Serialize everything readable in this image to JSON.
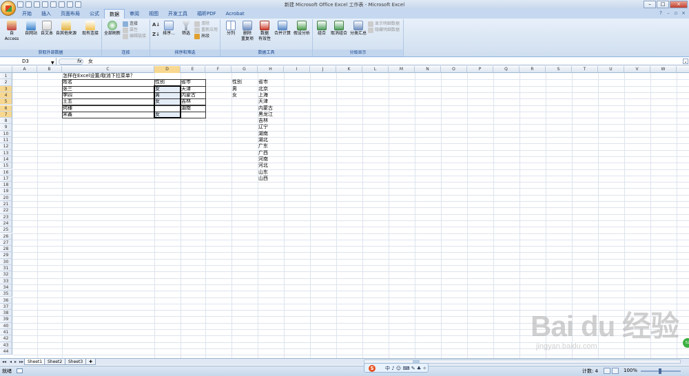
{
  "window": {
    "title": "新建 Microsoft Office Excel 工作表 - Microsoft Excel"
  },
  "ribbon_tabs": [
    {
      "label": "开始",
      "active": false
    },
    {
      "label": "插入",
      "active": false
    },
    {
      "label": "页面布局",
      "active": false
    },
    {
      "label": "公式",
      "active": false
    },
    {
      "label": "数据",
      "active": true
    },
    {
      "label": "审阅",
      "active": false
    },
    {
      "label": "视图",
      "active": false
    },
    {
      "label": "开发工具",
      "active": false
    },
    {
      "label": "福昕PDF",
      "active": false
    },
    {
      "label": "Acrobat",
      "active": false
    }
  ],
  "groups": {
    "external": {
      "title": "获取外部数据",
      "access": "自 Access",
      "web": "自网站",
      "text": "自文本",
      "other": "自其他来源",
      "existing": "现有连接"
    },
    "connections": {
      "title": "连接",
      "refresh_all": "全部刷新",
      "connections": "连接",
      "properties": "属性",
      "edit_links": "编辑链接"
    },
    "sort_filter": {
      "title": "排序和筛选",
      "sort": "排序...",
      "filter": "筛选",
      "clear": "清除",
      "reapply": "重新应用",
      "advanced": "高级"
    },
    "data_tools": {
      "title": "数据工具",
      "text_to_columns": "分列",
      "remove_dup_1": "删除",
      "remove_dup_2": "重复项",
      "validation_1": "数据",
      "validation_2": "有效性",
      "consolidate": "合并计算",
      "whatif": "假设分析"
    },
    "outline": {
      "title": "分级显示",
      "group": "组合",
      "ungroup": "取消组合",
      "subtotal": "分类汇总",
      "show_detail": "显示明细数据",
      "hide_detail": "隐藏明细数据"
    }
  },
  "formula_bar": {
    "name_box": "D3",
    "fx": "fx",
    "value": "女"
  },
  "columns": [
    "A",
    "B",
    "C",
    "D",
    "E",
    "F",
    "G",
    "H",
    "I",
    "J",
    "K",
    "L",
    "M",
    "N",
    "O",
    "P",
    "Q",
    "R",
    "S",
    "T",
    "U",
    "V",
    "W"
  ],
  "row_numbers": [
    "1",
    "2",
    "3",
    "4",
    "5",
    "6",
    "7",
    "8",
    "9",
    "10",
    "11",
    "12",
    "13",
    "14",
    "15",
    "16",
    "17",
    "18",
    "19",
    "20",
    "21",
    "22",
    "23",
    "24",
    "25",
    "26",
    "27",
    "28",
    "29",
    "30",
    "31",
    "32",
    "33",
    "34",
    "35",
    "36",
    "37",
    "38",
    "39",
    "40",
    "41",
    "42",
    "43",
    "44"
  ],
  "cells": {
    "c1": "怎样在Excel设置/取消下拉菜单？",
    "table_headers": [
      "姓名",
      "性别",
      "省市"
    ],
    "names": [
      "张三",
      "李四",
      "王五",
      "何様",
      "宋鑫"
    ],
    "genders": [
      "女",
      "男",
      "女",
      "",
      "女"
    ],
    "provinces": [
      "天津",
      "内蒙古",
      "吉林",
      "湖南",
      ""
    ],
    "g_header": "性别",
    "g_values": [
      "男",
      "女"
    ],
    "h_header": "省市",
    "h_values": [
      "北京",
      "上海",
      "天津",
      "内蒙古",
      "黑龙江",
      "吉林",
      "辽宁",
      "湖南",
      "湖北",
      "广东",
      "广西",
      "河南",
      "河北",
      "山东",
      "山西"
    ]
  },
  "sheets": [
    "Sheet1",
    "Sheet2",
    "Sheet3"
  ],
  "ime": {
    "logo": "S",
    "text": "中 ♪ ☺ ⌨ ✎ ♣ ✧"
  },
  "status": {
    "ready": "就绪",
    "count": "计数: 4",
    "zoom": "100%"
  },
  "watermark": {
    "main": "Bai du 经验",
    "sub": "jingyan.baidu.com"
  }
}
